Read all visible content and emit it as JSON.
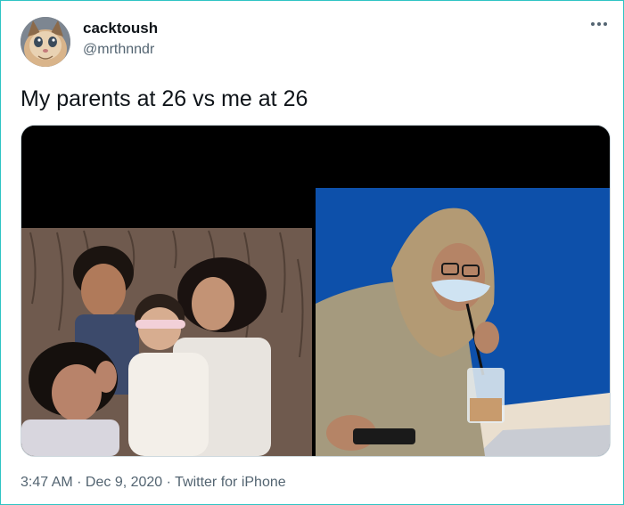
{
  "user": {
    "display_name": "cacktoush",
    "handle": "@mrthnndr",
    "avatar_icon": "cat-avatar"
  },
  "tweet": {
    "text": "My parents at 26 vs me at 26"
  },
  "media": {
    "photos": [
      {
        "description_icon": "family-photo"
      },
      {
        "description_icon": "cafe-photo"
      }
    ]
  },
  "meta": {
    "time": "3:47 AM",
    "separator": " · ",
    "date": "Dec 9, 2020",
    "source": "Twitter for iPhone"
  },
  "colors": {
    "border_accent": "#2fc4c4",
    "text_primary": "#0f1419",
    "text_secondary": "#536471",
    "bg_blue": "#0e56b4"
  }
}
